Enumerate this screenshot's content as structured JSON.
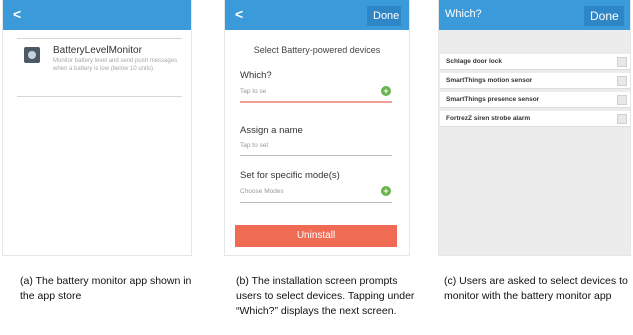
{
  "panel_a": {
    "back": "<",
    "app_name": "BatteryLevelMonitor",
    "app_description": "Monitor battery level and send push messages when a battery is low (below 10 units)"
  },
  "panel_b": {
    "back": "<",
    "done": "Done",
    "heading": "Select Battery-powered devices",
    "which_label": "Which?",
    "which_hint": "Tap to se",
    "name_label": "Assign a name",
    "name_hint": "Tap to set",
    "modes_label": "Set for specific mode(s)",
    "modes_hint": "Choose Modes",
    "plus_icon": "+",
    "uninstall": "Uninstall"
  },
  "panel_c": {
    "title": "Which?",
    "done": "Done",
    "devices": [
      "Schlage door lock",
      "SmartThings motion sensor",
      "SmartThings presence sensor",
      "FortrezZ siren strobe alarm"
    ]
  },
  "captions": {
    "a": "(a)  The battery monitor app shown in the app store",
    "b": "(b) The installation screen prompts users to select devices. Tapping under “Which?” displays the next screen.",
    "c": "(c)  Users are asked to select devices to monitor with the battery monitor app"
  },
  "colors": {
    "topbar": "#3b9ad9",
    "uninstall": "#ef6b54",
    "plus": "#67b54a"
  }
}
